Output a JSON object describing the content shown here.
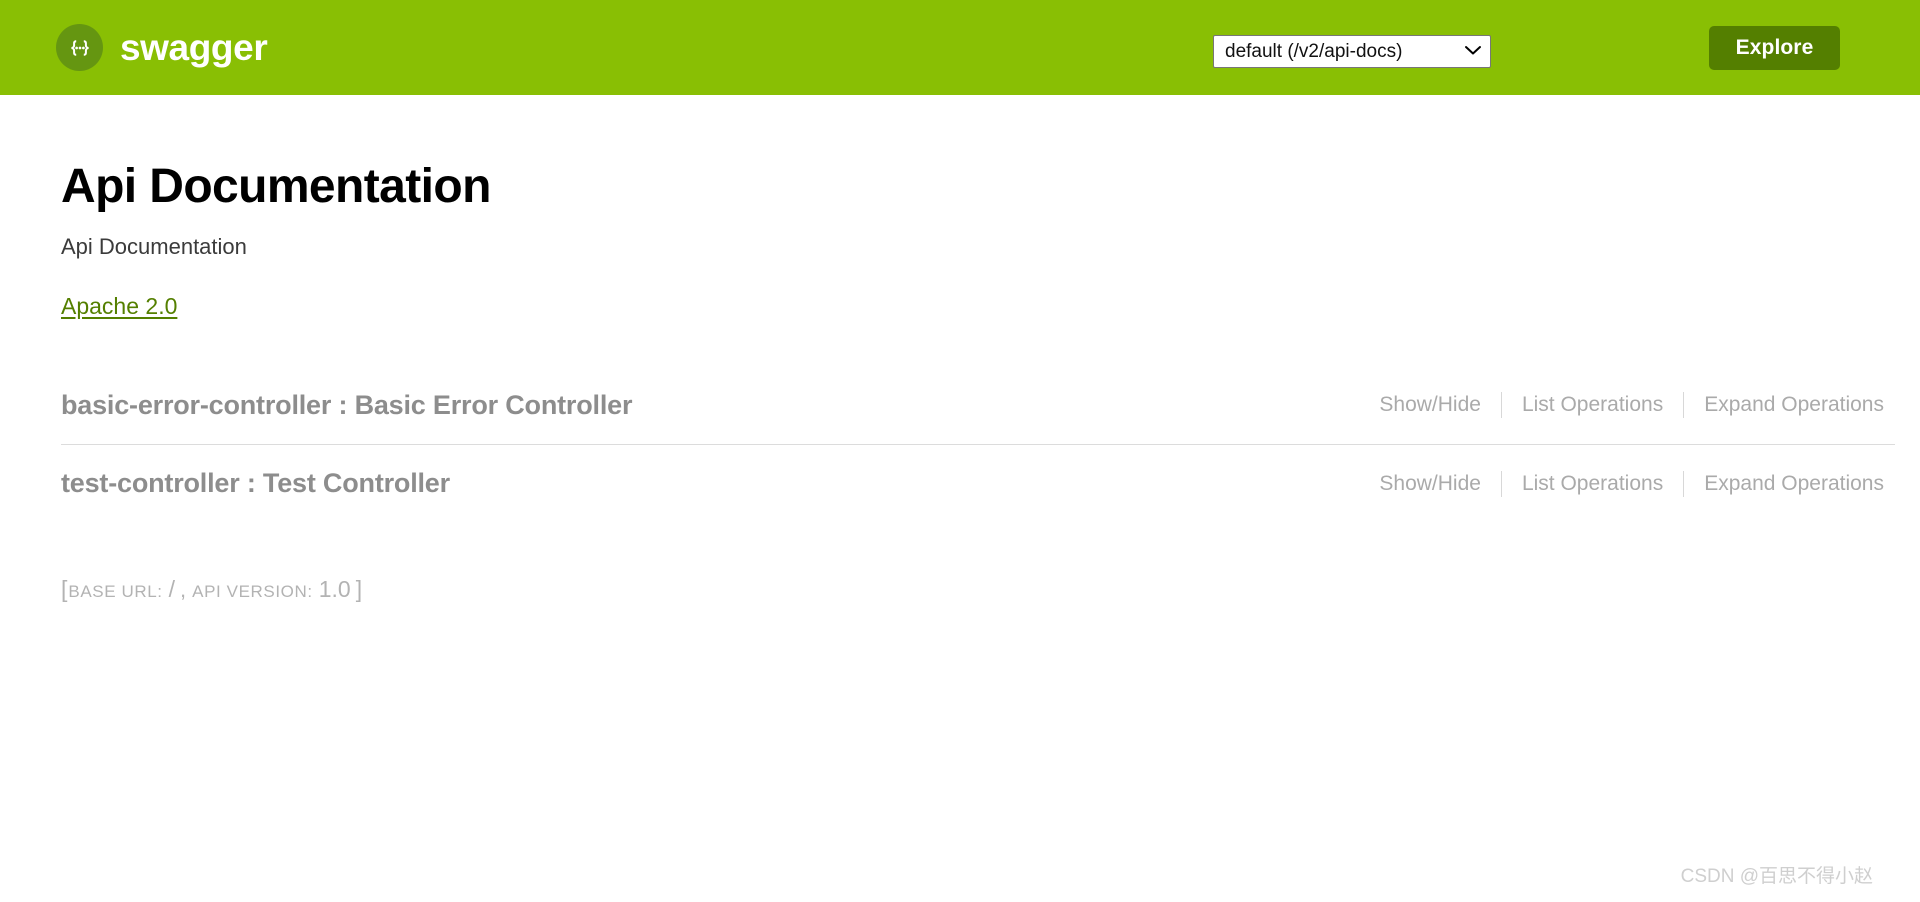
{
  "header": {
    "brand_name": "swagger",
    "logo_icon": "swagger-braces-icon",
    "api_select": {
      "value": "default (/v2/api-docs)",
      "chevron_icon": "chevron-down-icon",
      "options": [
        "default (/v2/api-docs)"
      ]
    },
    "explore_label": "Explore",
    "background_color": "#89bf04",
    "logo_color": "#659611",
    "explore_color": "#547f00"
  },
  "main": {
    "title": "Api Documentation",
    "subtitle": "Api Documentation",
    "license_label": "Apache 2.0",
    "license_color": "#547f00",
    "resources": [
      {
        "name": "basic-error-controller : Basic Error Controller",
        "show_hide": "Show/Hide",
        "list_operations": "List Operations",
        "expand_operations": "Expand Operations"
      },
      {
        "name": "test-controller : Test Controller",
        "show_hide": "Show/Hide",
        "list_operations": "List Operations",
        "expand_operations": "Expand Operations"
      }
    ],
    "footer": {
      "open_bracket": "[",
      "base_url_key": "BASE URL:",
      "base_url_value": "/",
      "comma": ",",
      "api_version_key": "API VERSION:",
      "api_version_value": "1.0",
      "close_bracket": "]"
    }
  },
  "watermark": "CSDN @百思不得小赵"
}
